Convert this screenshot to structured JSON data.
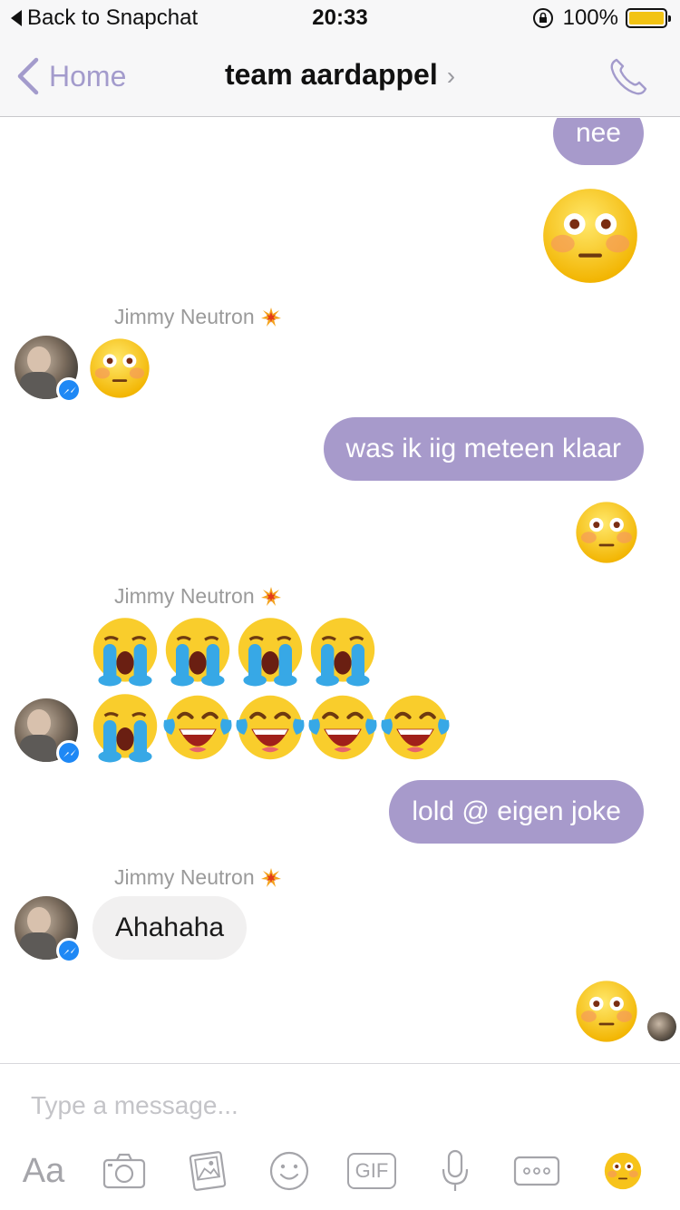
{
  "status_bar": {
    "back_label": "Back to Snapchat",
    "time": "20:33",
    "battery_text": "100%",
    "battery_level": 1.0,
    "battery_color": "#f2c314"
  },
  "nav": {
    "back_label": "Home",
    "title": "team aardappel",
    "chevron_icon": "chevron-right-icon",
    "call_icon": "phone-icon",
    "accent_color": "#a39bcc"
  },
  "messages": [
    {
      "direction": "outgoing",
      "type": "text",
      "text": "nee"
    },
    {
      "direction": "outgoing",
      "type": "emoji",
      "emoji": "flushed-face",
      "size": "large"
    },
    {
      "direction": "incoming",
      "sender": "Jimmy Neutron",
      "sender_badge": "collision-icon",
      "type": "emoji",
      "emoji": "flushed-face",
      "count": 1
    },
    {
      "direction": "outgoing",
      "type": "text",
      "text": "was ik iig meteen klaar"
    },
    {
      "direction": "outgoing",
      "type": "emoji",
      "emoji": "flushed-face"
    },
    {
      "direction": "incoming",
      "sender": "Jimmy Neutron",
      "sender_badge": "collision-icon",
      "type": "emoji-row",
      "rows": [
        [
          "crying",
          "crying",
          "crying",
          "crying"
        ],
        [
          "crying",
          "joy",
          "joy",
          "joy",
          "joy"
        ]
      ]
    },
    {
      "direction": "outgoing",
      "type": "text",
      "text": "lold @ eigen joke"
    },
    {
      "direction": "incoming",
      "sender": "Jimmy Neutron",
      "sender_badge": "collision-icon",
      "type": "text",
      "text": "Ahahaha"
    },
    {
      "direction": "outgoing",
      "type": "emoji",
      "emoji": "flushed-face",
      "seen_by_avatar": true
    }
  ],
  "composer": {
    "placeholder": "Type a message...",
    "tools": [
      "Aa",
      "camera-icon",
      "gallery-icon",
      "smiley-icon",
      "GIF",
      "microphone-icon",
      "more-icon",
      "flushed-emoji-icon"
    ]
  },
  "colors": {
    "outgoing_bubble": "#a79acb",
    "incoming_bubble": "#f1f0f0",
    "messenger_badge": "#1e88f5"
  }
}
